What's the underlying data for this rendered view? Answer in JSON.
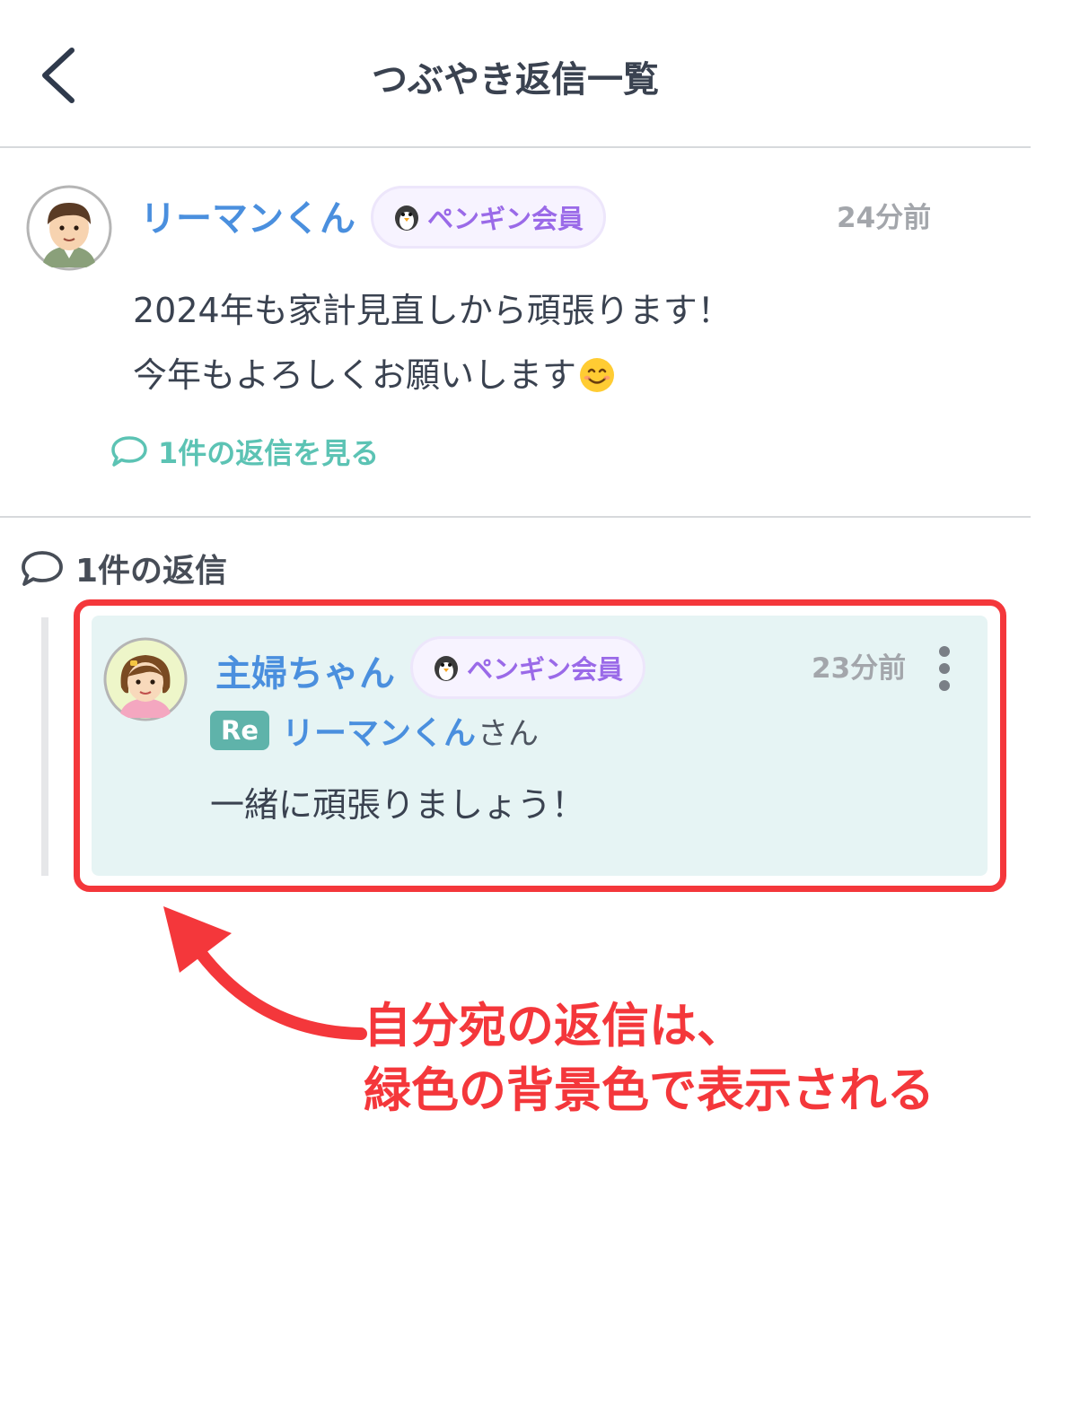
{
  "header": {
    "title": "つぶやき返信一覧",
    "back_icon": "chevron-left-icon"
  },
  "post": {
    "username": "リーマンくん",
    "badge": "ペンギン会員",
    "time": "24分前",
    "body_line1": "2024年も家計見直しから頑張ります！",
    "body_line2": "今年もよろしくお願いします",
    "emoji": "smiling-face-icon",
    "view_replies": "1件の返信を見る"
  },
  "replies": {
    "heading": "1件の返信",
    "items": [
      {
        "username": "主婦ちゃん",
        "badge": "ペンギン会員",
        "time": "23分前",
        "re_label": "Re",
        "reply_to": "リーマンくん",
        "reply_to_suffix": "さん",
        "body": "一緒に頑張りましょう！"
      }
    ]
  },
  "annotation": {
    "line1": "自分宛の返信は、",
    "line2": "緑色の背景色で表示される"
  },
  "colors": {
    "accent_blue": "#4a8fde",
    "teal": "#5cc3b4",
    "reply_bg": "#e6f4f4",
    "badge_purple": "#9a6ae8",
    "annotation_red": "#f4373b"
  }
}
